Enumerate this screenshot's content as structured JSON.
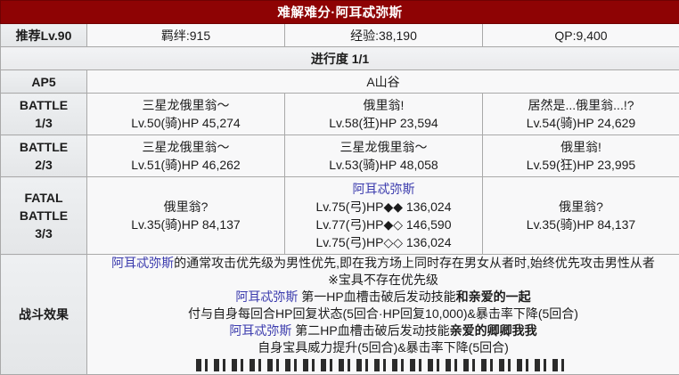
{
  "colors": {
    "header_bg": "#8e0304",
    "link": "#3a3aad"
  },
  "header": {
    "title": "难解难分·阿耳忒弥斯"
  },
  "summary": {
    "recommend": "推荐Lv.90",
    "bond": "羁绊:915",
    "exp": "经验:38,190",
    "qp": "QP:9,400"
  },
  "progress": {
    "label": "进行度 1/1"
  },
  "ap": {
    "label": "AP5",
    "location": "A山谷"
  },
  "battles": [
    {
      "label": "BATTLE",
      "round": "1/3",
      "enemies": [
        {
          "name": "三星龙俄里翁～",
          "stats": "Lv.50(骑)HP 45,274"
        },
        {
          "name": "俄里翁!",
          "stats": "Lv.58(狂)HP 23,594"
        },
        {
          "name": "居然是...俄里翁...!?",
          "stats": "Lv.54(骑)HP 24,629"
        }
      ]
    },
    {
      "label": "BATTLE",
      "round": "2/3",
      "enemies": [
        {
          "name": "三星龙俄里翁～",
          "stats": "Lv.51(骑)HP 46,262"
        },
        {
          "name": "三星龙俄里翁～",
          "stats": "Lv.53(骑)HP 48,058"
        },
        {
          "name": "俄里翁!",
          "stats": "Lv.59(狂)HP 23,995"
        }
      ]
    },
    {
      "label": "FATAL BATTLE",
      "round": "3/3",
      "enemies": [
        {
          "name": "俄里翁?",
          "stats": "Lv.35(骑)HP 84,137"
        },
        {
          "name": "阿耳忒弥斯",
          "is_link": true,
          "stats_lines": [
            "Lv.75(弓)HP◆◆ 136,024",
            "Lv.77(弓)HP◆◇ 146,590",
            "Lv.75(弓)HP◇◇ 136,024"
          ]
        },
        {
          "name": "俄里翁?",
          "stats": "Lv.35(骑)HP 84,137"
        }
      ]
    }
  ],
  "effects": {
    "label": "战斗效果",
    "line1_link": "阿耳忒弥斯",
    "line1_text": "的通常攻击优先级为男性优先,即在我方场上同时存在男女从者时,始终优先攻击男性从者",
    "line2": "※宝具不存在优先级",
    "line3_link": "阿耳忒弥斯",
    "line3_text": " 第一HP血槽击破后发动技能",
    "line3_skill": "和亲爱的一起",
    "line4": "付与自身每回合HP回复状态(5回合·HP回复10,000)&暴击率下降(5回合)",
    "line5_link": "阿耳忒弥斯",
    "line5_text": " 第二HP血槽击破后发动技能",
    "line5_skill": "亲爱的卿卿我我",
    "line6": "自身宝具威力提升(5回合)&暴击率下降(5回合)"
  }
}
